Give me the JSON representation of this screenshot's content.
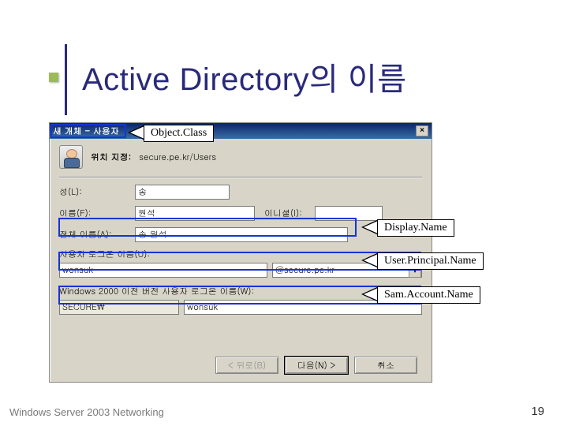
{
  "slide": {
    "title": "Active Directory의 이름",
    "footer_left": "Windows  Server 2003 Networking",
    "page_number": "19"
  },
  "dialog": {
    "title": "새 개체 - 사용자",
    "close": "×",
    "location_label": "위치 지정:",
    "location_value": "secure.pe.kr/Users",
    "lastname_label": "성(L):",
    "lastname_value": "송",
    "firstname_label": "이름(F):",
    "firstname_value": "원석",
    "initials_label": "이니셜(I):",
    "initials_value": "",
    "fullname_label": "전체 이름(A):",
    "fullname_value": "송 원석",
    "logon_label": "사용자 로그온 이름(U):",
    "logon_value": "wonsuk",
    "logon_domain": "@secure.pe.kr",
    "w2k_label": "Windows 2000 이전 버전 사용자 로그온 이름(W):",
    "w2k_domain": "SECURE\\",
    "w2k_value": "wonsuk",
    "btn_back": "< 뒤로(B)",
    "btn_next": "다음(N) >",
    "btn_cancel": "취소"
  },
  "callouts": {
    "object_class": "Object.Class",
    "display_name": "Display.Name",
    "upn": "User.Principal.Name",
    "sam": "Sam.Account.Name"
  }
}
